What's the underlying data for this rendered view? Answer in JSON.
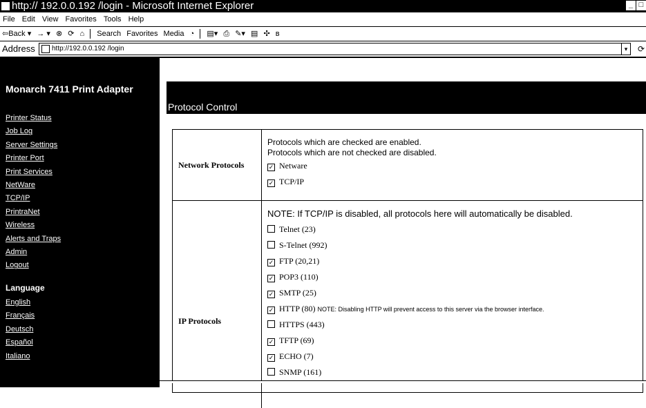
{
  "window": {
    "title": "http:// 192.0.0.192 /login - Microsoft Internet Explorer",
    "min": "_",
    "max": "□"
  },
  "menu": [
    "File",
    "Edit",
    "View",
    "Favorites",
    "Tools",
    "Help"
  ],
  "toolbar": {
    "back": "⇦Back ▾",
    "forward": "→ ▾",
    "stop": "⊗",
    "refresh": "⟳",
    "home": "⌂",
    "search": "Search",
    "favorites": "Favorites",
    "media": "Media",
    "history": "◔",
    "mail": "▤▾",
    "print": "⎙",
    "edit": "✎▾",
    "discuss": "▤",
    "messenger": "✣",
    "bluetooth": "ʙ"
  },
  "address": {
    "label": "Address",
    "url": "http://192.0.0.192 /login",
    "dropdown": "▾",
    "go": "⟳"
  },
  "sidebar": {
    "brand": "Monarch 7411 Print Adapter",
    "links": [
      "Printer Status",
      "Job Log",
      "Server Settings",
      "Printer Port",
      "Print Services",
      "NetWare",
      "TCP/IP",
      "PrintraNet",
      "Wireless",
      "Alerts and Traps",
      "Admin",
      "Logout"
    ],
    "language_heading": "Language",
    "languages": [
      "English",
      "Français",
      "Deutsch",
      "Español",
      "Italiano"
    ]
  },
  "page": {
    "title": "Protocol Control"
  },
  "network": {
    "label": "Network Protocols",
    "note1": "Protocols which are checked are enabled.",
    "note2": "Protocols which are not checked are disabled.",
    "items": [
      {
        "label": "Netware",
        "checked": true,
        "mark": "✓"
      },
      {
        "label": "TCP/IP",
        "checked": true,
        "mark": "✓"
      }
    ]
  },
  "ip": {
    "label": "IP Protocols",
    "note": "NOTE: If TCP/IP is disabled, all protocols here will automatically be disabled.",
    "items": [
      {
        "label": "Telnet (23)",
        "checked": false,
        "mark": ""
      },
      {
        "label": "S-Telnet (992)",
        "checked": false,
        "mark": ""
      },
      {
        "label": "FTP (20,21)",
        "checked": true,
        "mark": "✓"
      },
      {
        "label": "POP3 (110)",
        "checked": true,
        "mark": "✓"
      },
      {
        "label": "SMTP (25)",
        "checked": true,
        "mark": "✓"
      },
      {
        "label": "HTTP (80)",
        "checked": true,
        "mark": "✓",
        "note": "NOTE: Disabling HTTP will prevent access to this server via the browser interface."
      },
      {
        "label": "HTTPS (443)",
        "checked": false,
        "mark": ""
      },
      {
        "label": "TFTP (69)",
        "checked": true,
        "mark": "✓"
      },
      {
        "label": "ECHO (7)",
        "checked": true,
        "mark": "✓"
      },
      {
        "label": "SNMP (161)",
        "checked": false,
        "mark": ""
      }
    ]
  }
}
